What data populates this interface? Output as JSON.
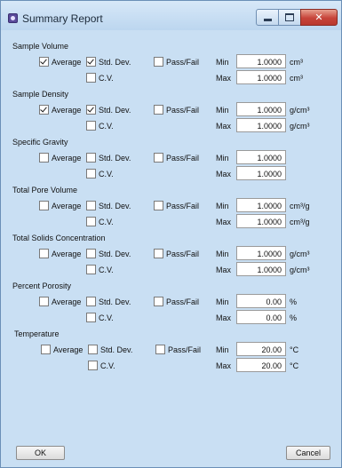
{
  "window": {
    "title": "Summary Report"
  },
  "labels": {
    "average": "Average",
    "std_dev": "Std. Dev.",
    "cv": "C.V.",
    "pass_fail": "Pass/Fail",
    "min": "Min",
    "max": "Max"
  },
  "sections": [
    {
      "title": "Sample Volume",
      "average_checked": true,
      "std_dev_checked": true,
      "cv_checked": false,
      "pass_fail_checked": false,
      "min": "1.0000",
      "max": "1.0000",
      "unit": "cm³"
    },
    {
      "title": "Sample Density",
      "average_checked": true,
      "std_dev_checked": true,
      "cv_checked": false,
      "pass_fail_checked": false,
      "min": "1.0000",
      "max": "1.0000",
      "unit": "g/cm³"
    },
    {
      "title": "Specific Gravity",
      "average_checked": false,
      "std_dev_checked": false,
      "cv_checked": false,
      "pass_fail_checked": false,
      "min": "1.0000",
      "max": "1.0000",
      "unit": ""
    },
    {
      "title": "Total Pore Volume",
      "average_checked": false,
      "std_dev_checked": false,
      "cv_checked": false,
      "pass_fail_checked": false,
      "min": "1.0000",
      "max": "1.0000",
      "unit": "cm³/g"
    },
    {
      "title": "Total Solids Concentration",
      "average_checked": false,
      "std_dev_checked": false,
      "cv_checked": false,
      "pass_fail_checked": false,
      "min": "1.0000",
      "max": "1.0000",
      "unit": "g/cm³"
    },
    {
      "title": "Percent Porosity",
      "average_checked": false,
      "std_dev_checked": false,
      "cv_checked": false,
      "pass_fail_checked": false,
      "min": "0.00",
      "max": "0.00",
      "unit": "%"
    },
    {
      "title": "Temperature",
      "average_checked": false,
      "std_dev_checked": false,
      "cv_checked": false,
      "pass_fail_checked": false,
      "min": "20.00",
      "max": "20.00",
      "unit": "°C"
    }
  ],
  "buttons": {
    "ok": "OK",
    "cancel": "Cancel"
  }
}
